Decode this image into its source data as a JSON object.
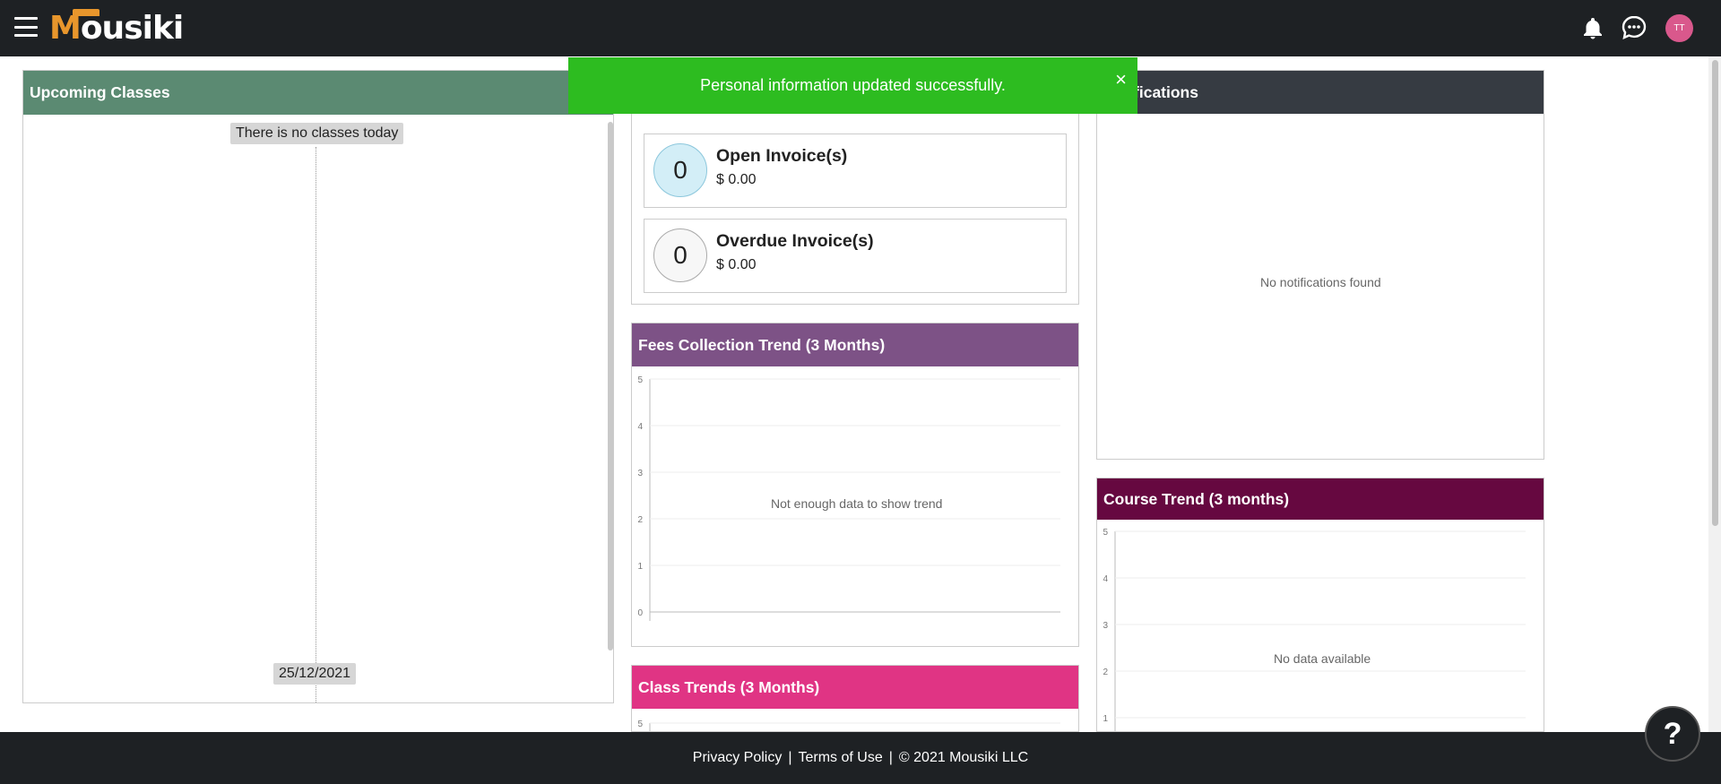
{
  "header": {
    "logo_text": "ousiki",
    "logo_initial": "M",
    "avatar_initials": "TT",
    "icons": [
      "menu-icon",
      "bell-icon",
      "chat-icon"
    ]
  },
  "toast": {
    "message": "Personal information updated successfully.",
    "close_label": "×"
  },
  "upcoming": {
    "title": "Upcoming Classes",
    "empty_message": "There is no classes today",
    "date": "25/12/2021"
  },
  "invoices": {
    "open": {
      "count": "0",
      "title": "Open Invoice(s)",
      "amount": "$ 0.00"
    },
    "overdue": {
      "count": "0",
      "title": "Overdue Invoice(s)",
      "amount": "$ 0.00"
    }
  },
  "notifications": {
    "title": "Notifications",
    "empty_message": "No notifications found"
  },
  "chart_data": [
    {
      "type": "line",
      "title": "Fees Collection Trend (3 Months)",
      "xlabel": "",
      "ylabel": "",
      "ylim": [
        0,
        5
      ],
      "yticks": [
        "0",
        "1",
        "2",
        "3",
        "4",
        "5"
      ],
      "grid": true,
      "series": [],
      "message": "Not enough data to show trend"
    },
    {
      "type": "line",
      "title": "Course Trend (3 months)",
      "xlabel": "",
      "ylabel": "",
      "ylim": [
        0,
        5
      ],
      "yticks": [
        "1",
        "2",
        "3",
        "4",
        "5"
      ],
      "grid": true,
      "series": [],
      "message": "No data available"
    },
    {
      "type": "line",
      "title": "Class Trends (3 Months)",
      "xlabel": "",
      "ylabel": "",
      "ylim": [
        0,
        5
      ],
      "yticks": [
        "5"
      ],
      "grid": true,
      "series": []
    }
  ],
  "footer": {
    "privacy": "Privacy Policy",
    "separator": "|",
    "terms": "Terms of Use",
    "copyright": "© 2021 Mousiki LLC"
  },
  "help": {
    "label": "?"
  },
  "colors": {
    "header_bg": "#1e2124",
    "upcoming_head": "#5b8a72",
    "fees_head": "#7d5286",
    "class_head": "#e03484",
    "notif_head": "#363b42",
    "course_head": "#660840",
    "toast_bg": "#2dbc20",
    "open_invoice_circle": "#d3eef7"
  }
}
